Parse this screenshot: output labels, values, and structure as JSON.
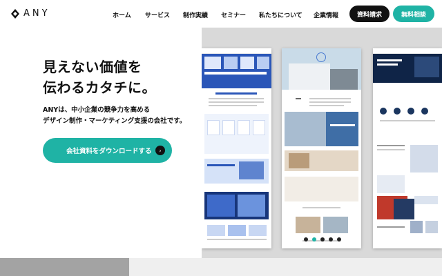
{
  "brand": {
    "name": "ANY",
    "accent": "#1fb3a5",
    "dark": "#111111"
  },
  "nav": {
    "items": [
      {
        "label": "ホーム"
      },
      {
        "label": "サービス"
      },
      {
        "label": "制作実績"
      },
      {
        "label": "セミナー"
      },
      {
        "label": "私たちについて"
      },
      {
        "label": "企業情報"
      }
    ],
    "docs_button": "資料請求",
    "consult_button": "無料相談"
  },
  "hero": {
    "headline_line1": "見えない価値を",
    "headline_line2": "伝わるカタチに。",
    "sub_line1": "ANYは、中小企業の競争力を高める",
    "sub_line2": "デザイン制作・マーケティング支援の会社です。",
    "cta_label": "会社資料をダウンロードする",
    "cta_icon": "arrow-right-icon"
  },
  "carousel": {
    "slide_count": 5,
    "active_index": 1
  }
}
